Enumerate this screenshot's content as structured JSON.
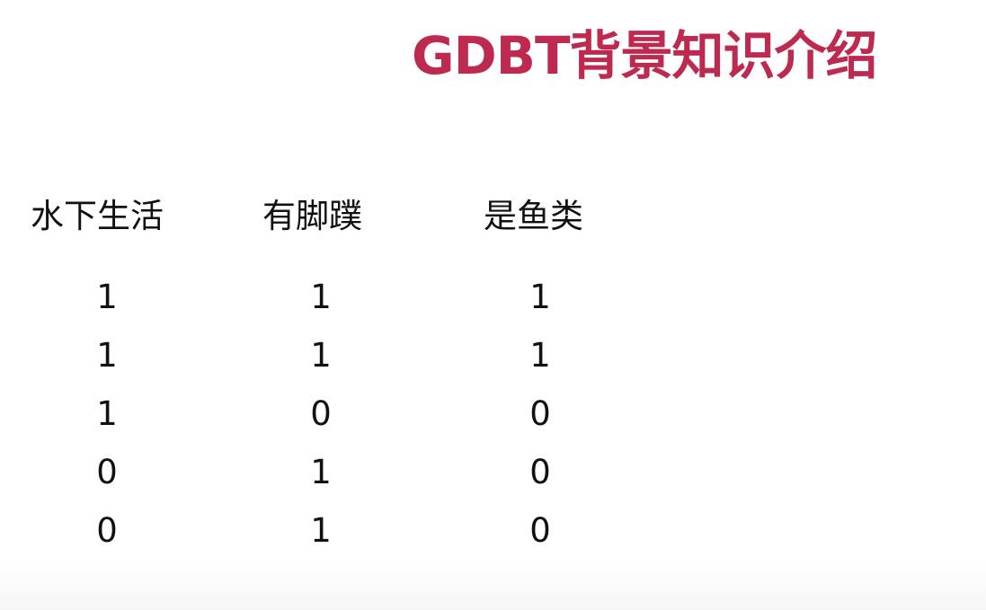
{
  "slide": {
    "title": "GDBT背景知识介绍",
    "title_color": "#be2a4f"
  },
  "table": {
    "headers": [
      "水下生活",
      "有脚蹼",
      "是鱼类"
    ],
    "rows": [
      [
        "1",
        "1",
        "1"
      ],
      [
        "1",
        "1",
        "1"
      ],
      [
        "1",
        "0",
        "0"
      ],
      [
        "0",
        "1",
        "0"
      ],
      [
        "0",
        "1",
        "0"
      ]
    ]
  }
}
